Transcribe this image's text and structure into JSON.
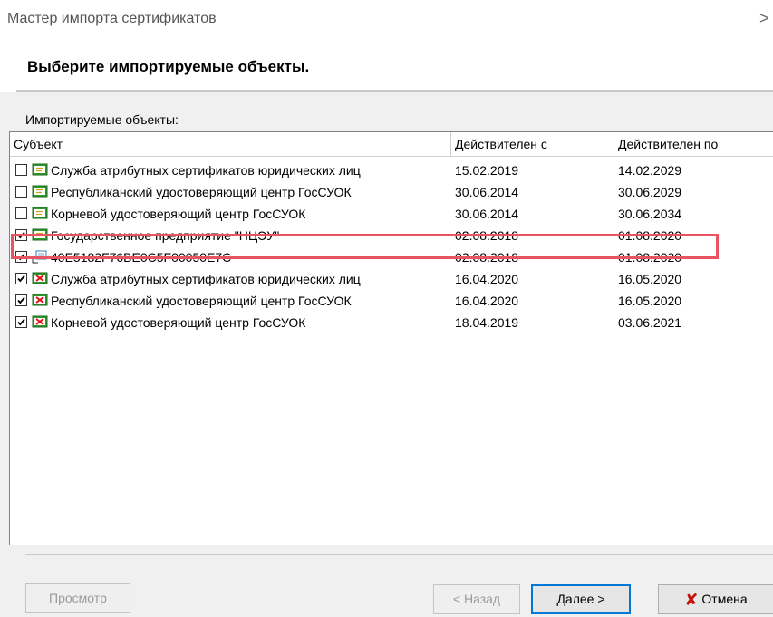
{
  "window": {
    "title": "Мастер импорта сертификатов",
    "close_glyph": ">"
  },
  "header": {
    "title": "Выберите импортируемые объекты."
  },
  "group": {
    "label": "Импортируемые объекты:"
  },
  "table": {
    "columns": [
      "Субъект",
      "Действителен с",
      "Действителен по"
    ],
    "rows": [
      {
        "checked": false,
        "icon": "certificate-icon",
        "subject": "Служба атрибутных сертификатов юридических лиц",
        "valid_from": "15.02.2019",
        "valid_to": "14.02.2029"
      },
      {
        "checked": false,
        "icon": "certificate-icon",
        "subject": "Республиканский удостоверяющий центр ГосСУОК",
        "valid_from": "30.06.2014",
        "valid_to": "30.06.2029"
      },
      {
        "checked": false,
        "icon": "certificate-icon",
        "subject": "Корневой удостоверяющий центр ГосСУОК",
        "valid_from": "30.06.2014",
        "valid_to": "30.06.2034"
      },
      {
        "checked": true,
        "icon": "certificate-icon",
        "subject": "Государственное предприятие \"НЦЭУ\"",
        "valid_from": "02.08.2018",
        "valid_to": "01.08.2020"
      },
      {
        "checked": true,
        "icon": "attribute-certificate-icon",
        "subject": "40E5182F76BE0C5F00050E7C",
        "valid_from": "02.08.2018",
        "valid_to": "01.08.2020"
      },
      {
        "checked": true,
        "icon": "revoked-certificate-icon",
        "subject": "Служба атрибутных сертификатов юридических лиц",
        "valid_from": "16.04.2020",
        "valid_to": "16.05.2020"
      },
      {
        "checked": true,
        "icon": "revoked-certificate-icon",
        "subject": "Республиканский удостоверяющий центр ГосСУОК",
        "valid_from": "16.04.2020",
        "valid_to": "16.05.2020"
      },
      {
        "checked": true,
        "icon": "revoked-certificate-icon",
        "subject": "Корневой удостоверяющий центр ГосСУОК",
        "valid_from": "18.04.2019",
        "valid_to": "03.06.2021"
      }
    ]
  },
  "buttons": {
    "view": "Просмотр",
    "back": "< Назад",
    "next": "Далее >",
    "cancel": "Отмена"
  },
  "colors": {
    "highlight": "#e8545f",
    "primary_border": "#0078d7",
    "cancel_icon": "#c4120c"
  }
}
